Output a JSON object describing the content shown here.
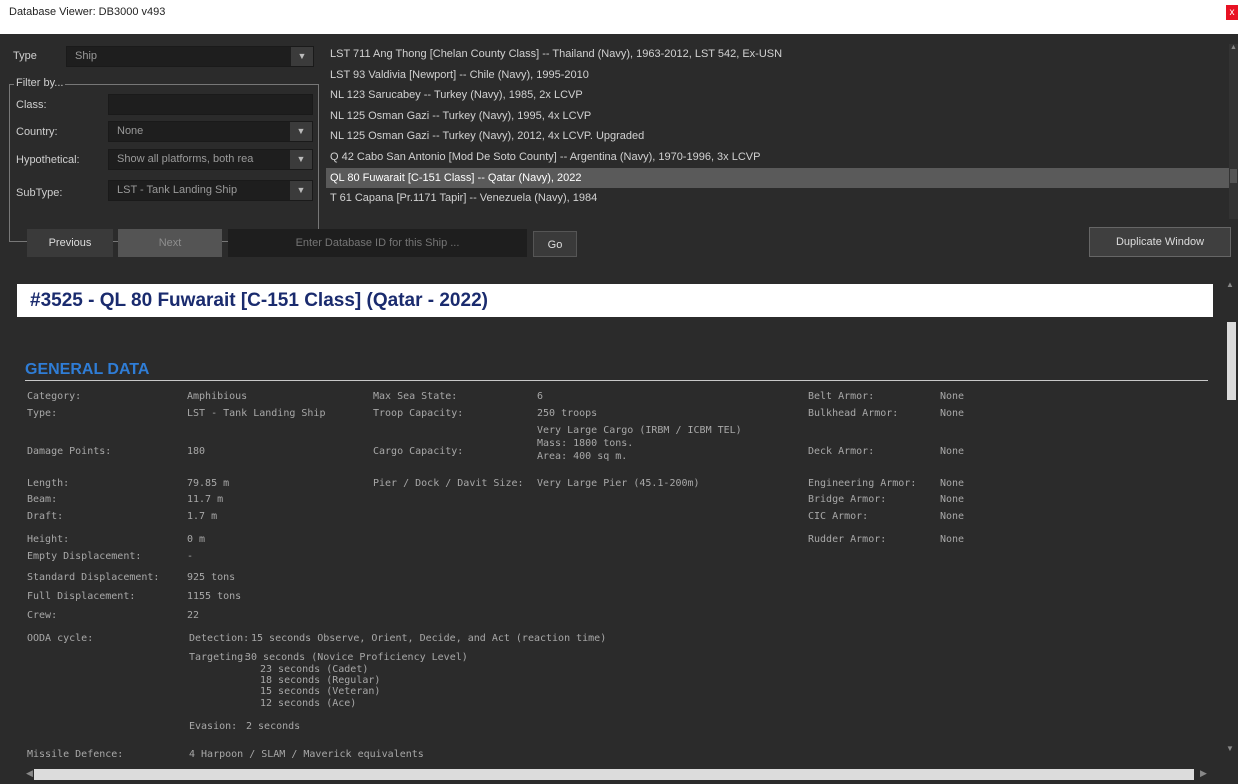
{
  "window": {
    "title": "Database Viewer: DB3000 v493",
    "close_glyph": "x"
  },
  "filters": {
    "type_label": "Type",
    "type_value": "Ship",
    "filter_by_label": "Filter by...",
    "class_label": "Class:",
    "class_value": "",
    "country_label": "Country:",
    "country_value": "None",
    "hypothetical_label": "Hypothetical:",
    "hypothetical_value": "Show all platforms, both rea",
    "subtype_label": "SubType:",
    "subtype_value": "LST - Tank Landing Ship",
    "dropdown_icon": "chevron-down-icon"
  },
  "results": [
    "LST 711 Ang Thong [Chelan County Class] -- Thailand (Navy), 1963-2012, LST 542, Ex-USN",
    "LST 93 Valdivia [Newport] -- Chile (Navy), 1995-2010",
    "NL 123 Sarucabey -- Turkey (Navy), 1985, 2x LCVP",
    "NL 125 Osman Gazi -- Turkey (Navy), 1995, 4x LCVP",
    "NL 125 Osman Gazi -- Turkey (Navy), 2012, 4x LCVP. Upgraded",
    "Q 42 Cabo San Antonio [Mod De Soto County] -- Argentina (Navy), 1970-1996, 3x LCVP",
    "QL 80 Fuwarait [C-151 Class] -- Qatar (Navy), 2022",
    "T 61 Capana [Pr.1171 Tapir] -- Venezuela (Navy), 1984"
  ],
  "selected_index": 6,
  "nav": {
    "previous_label": "Previous",
    "next_label": "Next",
    "db_input_placeholder": "Enter Database ID for this Ship ...",
    "go_label": "Go",
    "duplicate_label": "Duplicate Window"
  },
  "doc": {
    "title": "#3525 - QL 80 Fuwarait [C-151 Class] (Qatar - 2022)",
    "general_heading": "GENERAL DATA",
    "col1": [
      {
        "k": "Category:",
        "v": "Amphibious"
      },
      {
        "k": "Type:",
        "v": "LST - Tank Landing Ship"
      },
      {
        "k": "Damage Points:",
        "v": "180"
      },
      {
        "k": "Length:",
        "v": "79.85 m"
      },
      {
        "k": "Beam:",
        "v": "11.7 m"
      },
      {
        "k": "Draft:",
        "v": "1.7 m"
      },
      {
        "k": "Height:",
        "v": "0 m"
      },
      {
        "k": "Empty Displacement:",
        "v": "-"
      },
      {
        "k": "Standard Displacement:",
        "v": "925 tons"
      },
      {
        "k": "Full Displacement:",
        "v": "1155 tons"
      },
      {
        "k": "Crew:",
        "v": "22"
      }
    ],
    "col2": [
      {
        "k": "Max Sea State:",
        "v": "6"
      },
      {
        "k": "Troop Capacity:",
        "v": "250 troops"
      },
      {
        "k": "Cargo Capacity:",
        "v": "Very Large Cargo (IRBM / ICBM TEL)\nMass: 1800 tons.\nArea: 400 sq m."
      },
      {
        "k": "Pier / Dock / Davit Size:",
        "v": "Very Large Pier (45.1-200m)"
      }
    ],
    "col3": [
      {
        "k": "Belt Armor:",
        "v": "None"
      },
      {
        "k": "Bulkhead Armor:",
        "v": "None"
      },
      {
        "k": "Deck Armor:",
        "v": "None"
      },
      {
        "k": "Engineering Armor:",
        "v": "None"
      },
      {
        "k": "Bridge Armor:",
        "v": "None"
      },
      {
        "k": "CIC Armor:",
        "v": "None"
      },
      {
        "k": "Rudder Armor:",
        "v": "None"
      }
    ],
    "ooda": {
      "label": "OODA cycle:",
      "detection_label": "Detection:",
      "detection_value": "15 seconds Observe, Orient, Decide, and Act (reaction time)",
      "targeting_label": "Targeting:",
      "targeting_values": [
        "30 seconds (Novice Proficiency Level)",
        "23 seconds (Cadet)",
        "18 seconds (Regular)",
        "15 seconds (Veteran)",
        "12 seconds (Ace)"
      ],
      "evasion_label": "Evasion:",
      "evasion_value": "2 seconds"
    },
    "missile_defence_label": "Missile Defence:",
    "missile_defence_value": "4 Harpoon / SLAM / Maverick equivalents"
  }
}
